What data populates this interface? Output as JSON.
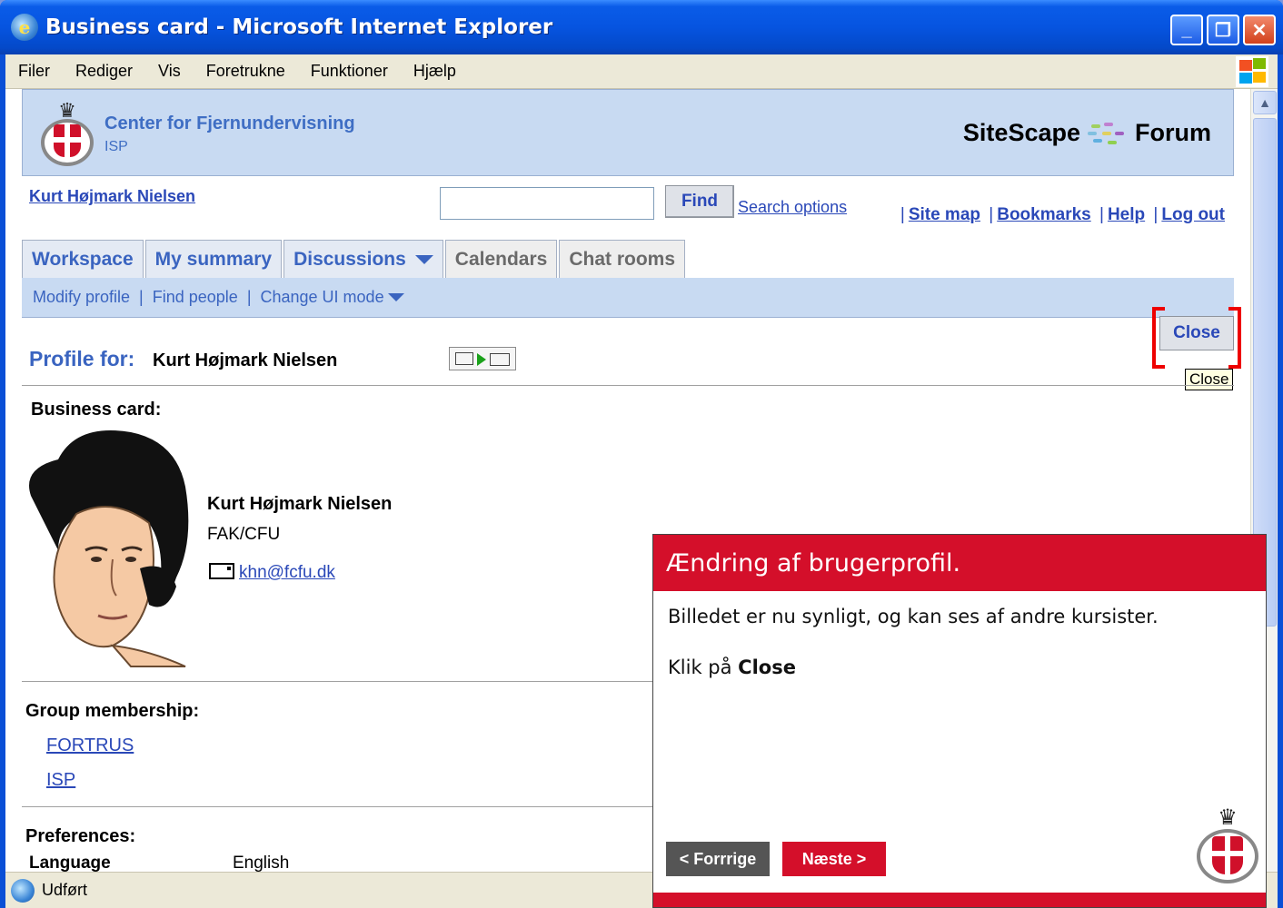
{
  "window": {
    "title": "Business card - Microsoft Internet Explorer",
    "status": "Udført"
  },
  "menu": [
    "Filer",
    "Rediger",
    "Vis",
    "Foretrukne",
    "Funktioner",
    "Hjælp"
  ],
  "banner": {
    "org_name": "Center for Fjernundervisning",
    "org_sub": "ISP",
    "brand_left": "SiteScape",
    "brand_right": "Forum"
  },
  "user": {
    "name_link": "Kurt Højmark Nielsen",
    "search_value": "",
    "find_label": "Find",
    "search_options": "Search options",
    "links": [
      "Site map",
      "Bookmarks",
      "Help",
      "Log out"
    ]
  },
  "tabs": [
    "Workspace",
    "My summary",
    "Discussions",
    "Calendars",
    "Chat rooms"
  ],
  "subnav": [
    "Modify profile",
    "Find people",
    "Change UI mode"
  ],
  "close": {
    "label": "Close",
    "tooltip": "Close"
  },
  "profile": {
    "title": "Profile for:",
    "name": "Kurt Højmark Nielsen",
    "business_card_label": "Business card:",
    "card_name": "Kurt Højmark Nielsen",
    "card_org": "FAK/CFU",
    "card_email": "khn@fcfu.dk",
    "group_label": "Group membership:",
    "groups": [
      "FORTRUS",
      "ISP"
    ],
    "preferences_label": "Preferences:",
    "pref_key": "Language",
    "pref_value": "English"
  },
  "tutorial": {
    "title": "Ændring af brugerprofil.",
    "text1": "Billedet er nu synligt, og kan ses af andre kursister.",
    "text2_prefix": "Klik på ",
    "text2_bold": "Close",
    "prev_label": "< Forrrige",
    "next_label": "Næste >"
  },
  "colors": {
    "accent": "#3a64c0",
    "banner_bg": "#c8daf2",
    "tutorial_red": "#d40f2a"
  }
}
